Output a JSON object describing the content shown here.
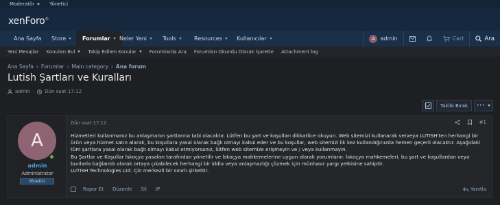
{
  "staffbar": {
    "moderator": "Moderatör",
    "admin": "Yönetici"
  },
  "header": {
    "logo": "xenForo"
  },
  "nav": {
    "tabs": [
      "Ana Sayfa",
      "Store",
      "Forumlar",
      "Neler Yeni",
      "Tools",
      "Resources",
      "Kullanıcılar"
    ],
    "selected": "Forumlar",
    "user": "admin",
    "user_initial": "A",
    "cart": "Cart",
    "search": "Ara"
  },
  "subnav": [
    "Yeni Mesajlar",
    "Konuları Bul",
    "Takip Edilen Konular",
    "Forumlarda Ara",
    "Forumları Okundu Olarak İşaretle",
    "Attachment log"
  ],
  "breadcrumb": [
    "Ana Sayfa",
    "Forumlar",
    "Main category",
    "Ana forum"
  ],
  "thread": {
    "title": "Lutish Şartları ve Kuralları",
    "author": "admin",
    "date": "Dün saat 17:12"
  },
  "actions": {
    "unwatch": "Takibi Bırak",
    "more": "•••"
  },
  "post": {
    "username": "admin",
    "initial": "A",
    "user_title": "Administrator",
    "banner": "Yönetici",
    "date": "Dün saat 17:12",
    "number": "#1",
    "body": [
      "Hizmetleri kullanmanız bu anlaşmanın şartlarına tabi olacaktır. Lütfen bu şart ve koşulları dikkatlice okuyun. Web sitemizi kullanarak ve/veya LUTISH'ten herhangi bir",
      "ürün veya hizmet satın alarak, bu koşullara yasal olarak bağlı olmayı kabul eder ve bu koşullar, web sitemizi ilk kez kullandığınızda hemen geçerli olacaktır. Aşağıdaki",
      "tüm şartlara yasal olarak bağlı olmayı kabul etmiyorsanız, lütfen web sitemize erişmeyin ve / veya kullanmayın.",
      "Bu Şartlar ve Koşullar İskoçya yasaları tarafından yönetilir ve İskoçya mahkemelerine uygun olarak yorumlanır. İskoçya mahkemeleri, bu şart ve koşullardan veya",
      "bunlarla bağlantılı olarak ortaya çıkabilecek herhangi bir iddia veya anlaşmazlığı çözmek için münhasır yargı yetkisine sahiptir.",
      "LUTISH Technologies Ltd. Çin merkezli bir sınırlı şirkettir."
    ],
    "actions": [
      "Rapor Et",
      "Düzenle",
      "Sil",
      "IP"
    ],
    "reply": "Yanıtla"
  },
  "colors": {
    "accent": "#4fa3e0",
    "header": "#16283d",
    "nav": "#1a3049",
    "page_bg": "#1e1f22"
  }
}
